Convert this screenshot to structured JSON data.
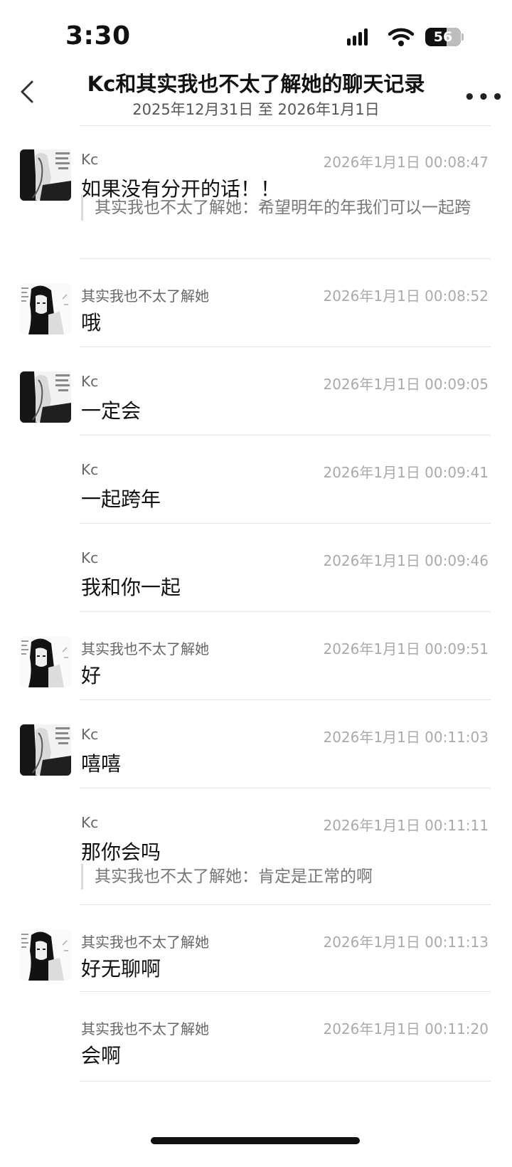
{
  "status": {
    "time": "3:30",
    "battery": "56"
  },
  "header": {
    "title": "Kc和其实我也不太了解她的聊天记录",
    "subtitle": "2025年12月31日 至 2026年1月1日"
  },
  "messages": [
    {
      "sender": "Kc",
      "time": "2026年1月1日 00:08:47",
      "text": "如果没有分开的话！！",
      "quote": "其实我也不太了解她：希望明年的年我们可以一起跨"
    },
    {
      "sender": "其实我也不太了解她",
      "time": "2026年1月1日 00:08:52",
      "text": "哦"
    },
    {
      "sender": "Kc",
      "time": "2026年1月1日 00:09:05",
      "text": "一定会"
    },
    {
      "sender": "Kc",
      "time": "2026年1月1日 00:09:41",
      "text": "一起跨年"
    },
    {
      "sender": "Kc",
      "time": "2026年1月1日 00:09:46",
      "text": "我和你一起"
    },
    {
      "sender": "其实我也不太了解她",
      "time": "2026年1月1日 00:09:51",
      "text": "好"
    },
    {
      "sender": "Kc",
      "time": "2026年1月1日 00:11:03",
      "text": "嘻嘻"
    },
    {
      "sender": "Kc",
      "time": "2026年1月1日 00:11:11",
      "text": "那你会吗",
      "quote": "其实我也不太了解她：肯定是正常的啊"
    },
    {
      "sender": "其实我也不太了解她",
      "time": "2026年1月1日 00:11:13",
      "text": "好无聊啊"
    },
    {
      "sender": "其实我也不太了解她",
      "time": "2026年1月1日 00:11:20",
      "text": "会啊"
    }
  ]
}
